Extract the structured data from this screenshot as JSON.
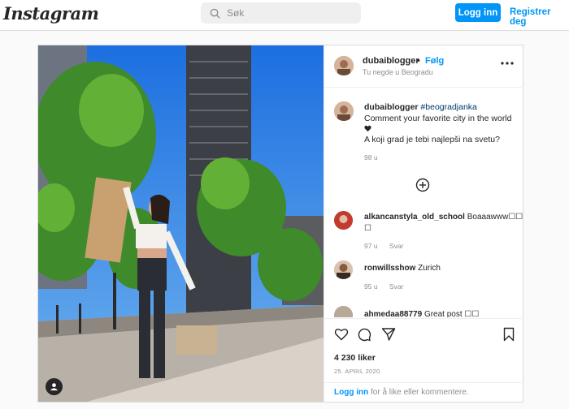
{
  "nav": {
    "logo": "Instagram",
    "search_placeholder": "Søk",
    "login_label": "Logg inn",
    "register_label": "Registrer deg"
  },
  "post": {
    "author": {
      "username": "dubaiblogger",
      "follow_label": "Følg",
      "location": "Tu negde u Beogradu"
    },
    "caption": {
      "username": "dubaiblogger",
      "hashtag": "#beogradjanka",
      "line1": "Comment your favorite city in the world",
      "line2": "A koji grad je tebi najlepši na svetu?",
      "time": "98 u"
    },
    "comments": [
      {
        "username": "alkancanstyla_old_school",
        "text": "Boaaawww☐☐",
        "text_cont": "☐",
        "time": "97 u",
        "reply": "Svar"
      },
      {
        "username": "ronwillsshow",
        "text": "Zurich",
        "time": "95 u",
        "reply": "Svar"
      },
      {
        "username": "ahmedaa88779",
        "text": "Great post ☐☐"
      }
    ],
    "likes": "4 230 liker",
    "date": "25. APRIL 2020",
    "footer": {
      "login": "Logg inn",
      "rest": " for å like eller kommentere."
    }
  },
  "colors": {
    "accent": "#0095f6",
    "border": "#dbdbdb",
    "text": "#262626",
    "muted": "#8e8e8e"
  },
  "icons": [
    "search-icon",
    "more-icon",
    "heart-icon",
    "plus-circle-icon",
    "like-icon",
    "comment-icon",
    "share-icon",
    "save-icon",
    "user-tag-icon"
  ]
}
